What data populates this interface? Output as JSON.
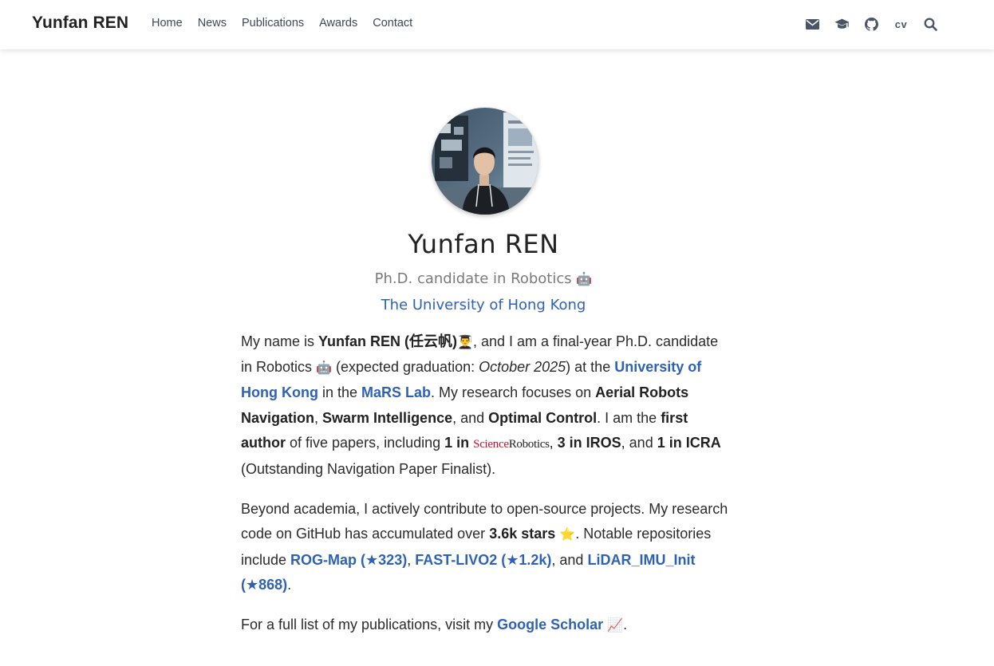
{
  "nav": {
    "brand": "Yunfan REN",
    "links": [
      "Home",
      "News",
      "Publications",
      "Awards",
      "Contact"
    ],
    "icons": [
      "email-icon",
      "graduation-cap-icon",
      "github-icon",
      "cv-icon",
      "search-icon"
    ],
    "cv_label": "cv"
  },
  "profile": {
    "name": "Yunfan REN",
    "title": "Ph.D. candidate in Robotics",
    "title_emoji": "🤖",
    "affiliation": "The University of Hong Kong"
  },
  "bio": {
    "p1": {
      "t1": "My name is ",
      "name": "Yunfan REN (任云帆)",
      "e1": "👨‍🎓",
      "t2": ", and I am a final-year Ph.D. candidate in Robotics ",
      "e2": "🤖",
      "t3": " (expected graduation: ",
      "grad": "October 2025",
      "t4": ") at the ",
      "link_hku": "University of Hong Kong",
      "t5": " in the ",
      "link_mars": "MaRS Lab",
      "t6": ". My research focuses on ",
      "f1": "Aerial Robots Navigation",
      "t7": ", ",
      "f2": "Swarm Intelligence",
      "t8": ", and ",
      "f3": "Optimal Control",
      "t9": ". I am the ",
      "fa": "first author",
      "t10": " of five papers, including ",
      "sr_count": "1 in",
      "sr_logo_a": "Science",
      "sr_logo_b": "Robotics",
      "t11": ", ",
      "iros": "3 in IROS",
      "t12": ", and ",
      "icra": "1 in ICRA",
      "t13": " (Outstanding Navigation Paper Finalist)."
    },
    "p2": {
      "t1": "Beyond academia, I actively contribute to open-source projects. My research code on GitHub has accumulated over ",
      "stars": "3.6k stars",
      "star_emoji": "⭐",
      "t2": ". Notable repositories include ",
      "repo1": "ROG-Map (★323)",
      "t3": ", ",
      "repo2": "FAST-LIVO2 (★1.2k)",
      "t4": ", and ",
      "repo3": "LiDAR_IMU_Init (★868)",
      "t5": "."
    },
    "p3": {
      "t1": "For a full list of my publications, visit my ",
      "scholar": "Google Scholar",
      "chart_emoji": "📈",
      "t2": "."
    }
  }
}
